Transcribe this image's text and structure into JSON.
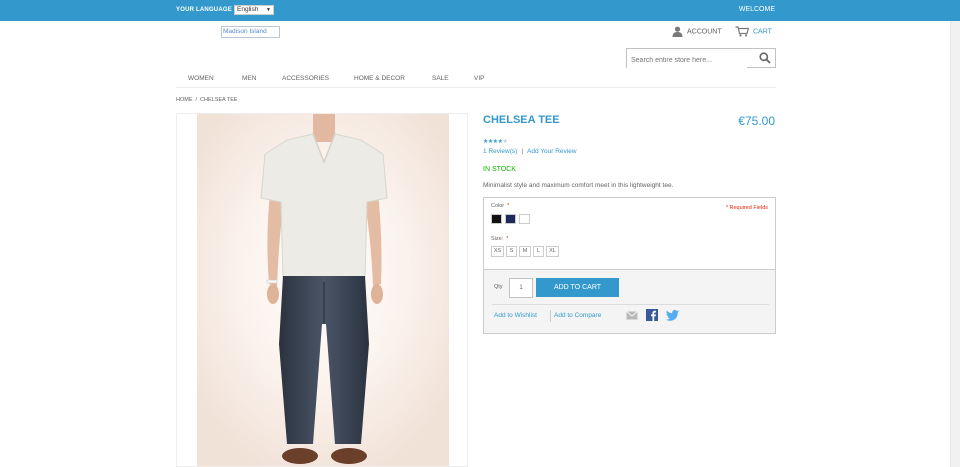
{
  "header": {
    "language_label": "YOUR LANGUAGE",
    "language_value": "English",
    "welcome": "WELCOME",
    "logo_alt": "Madison Island",
    "account_label": "ACCOUNT",
    "cart_label": "CART",
    "search_placeholder": "Search entire store here..."
  },
  "nav": {
    "items": [
      "WOMEN",
      "MEN",
      "ACCESSORIES",
      "HOME & DECOR",
      "SALE",
      "VIP"
    ]
  },
  "breadcrumb": {
    "home": "HOME",
    "separator": "/",
    "current": "CHELSEA TEE"
  },
  "product": {
    "name": "CHELSEA TEE",
    "price": "€75.00",
    "rating": 4,
    "rating_max": 5,
    "reviews_link": "1 Review(s)",
    "reviews_sep": "|",
    "add_review_link": "Add Your Review",
    "stock": "IN STOCK",
    "description": "Minimalist style and maximum comfort meet in this lightweight tee.",
    "color_label": "Color",
    "required_mark": "*",
    "required_fields": "* Required Fields",
    "swatches": [
      "#111111",
      "#1f2a5c",
      "#ffffff"
    ],
    "size_label": "Size:",
    "sizes": [
      "XS",
      "S",
      "M",
      "L",
      "XL"
    ],
    "qty_label": "Qty",
    "qty_value": "1",
    "add_to_cart": "ADD TO CART",
    "wishlist": "Add to Wishlist",
    "compare": "Add to Compare"
  },
  "colors": {
    "accent": "#3399cc",
    "stock": "#11b400",
    "required": "#df280a"
  },
  "icons": [
    "account-icon",
    "cart-icon",
    "search-icon",
    "email-icon",
    "facebook-icon",
    "twitter-icon"
  ]
}
